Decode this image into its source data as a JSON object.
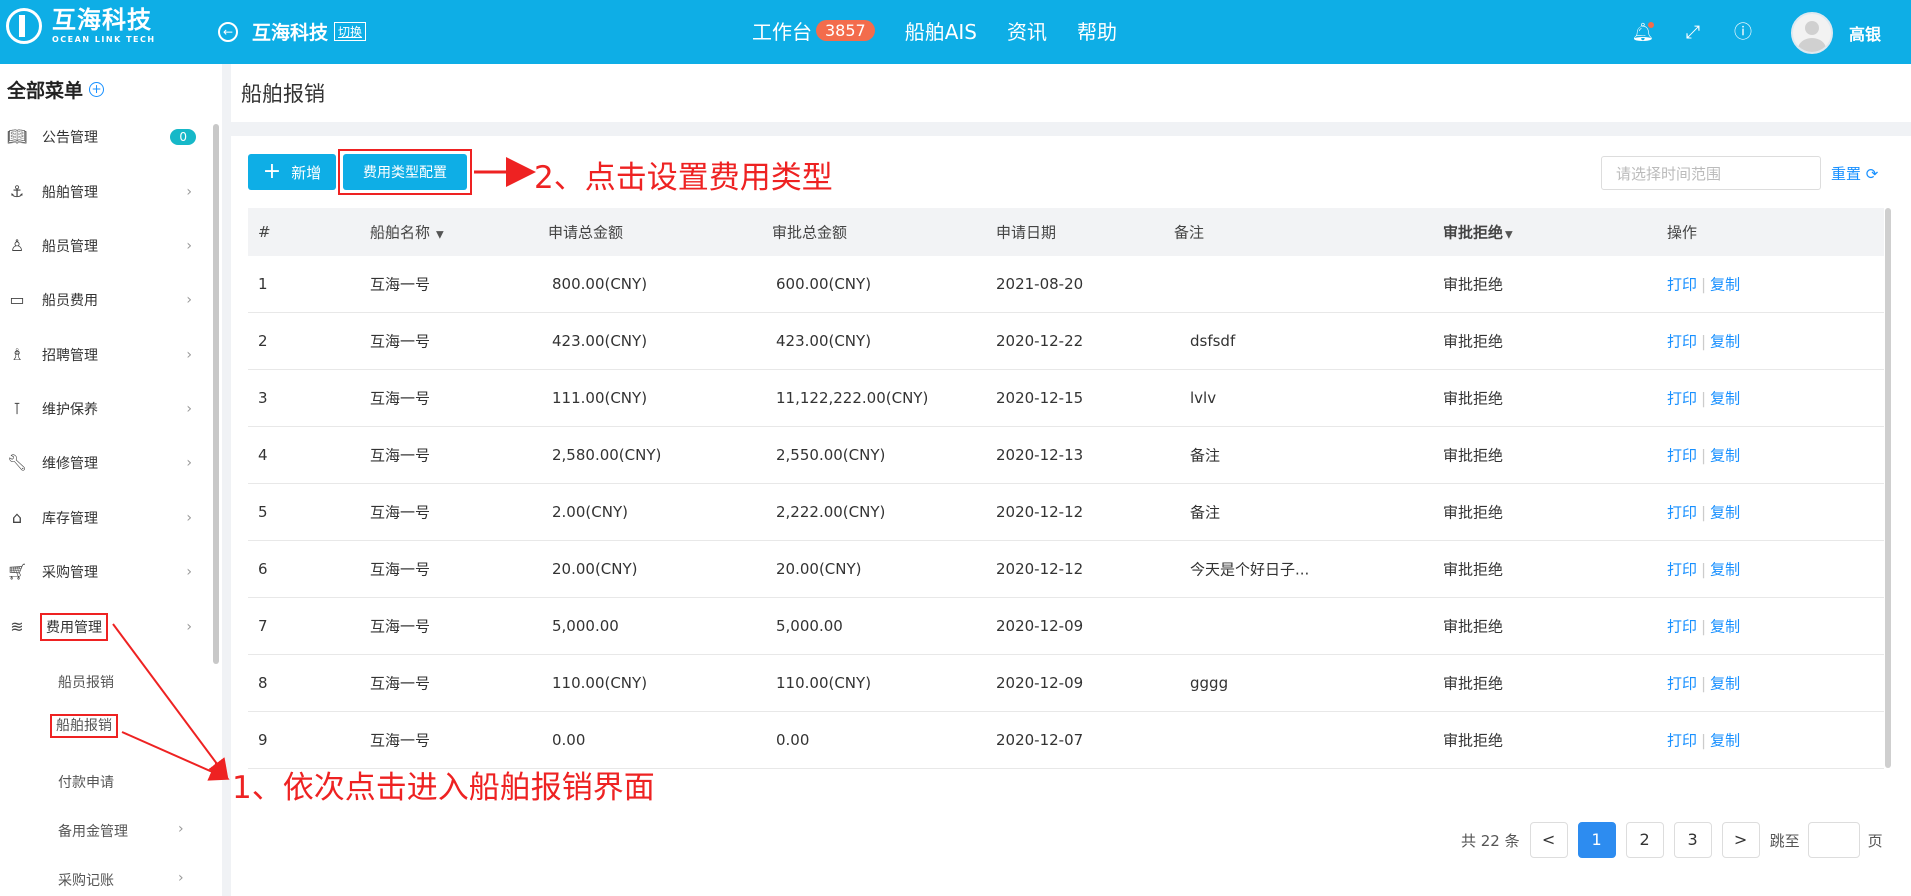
{
  "header": {
    "logo_cn": "互海科技",
    "logo_en": "OCEAN LINK TECH",
    "company": "互海科技",
    "switch_label": "切换",
    "nav": [
      {
        "label": "工作台",
        "badge": "3857"
      },
      {
        "label": "船舶AIS"
      },
      {
        "label": "资讯"
      },
      {
        "label": "帮助"
      }
    ],
    "user_name": "高银",
    "icons": [
      "bell-icon",
      "fullscreen-icon",
      "help-icon"
    ]
  },
  "sidebar": {
    "title": "全部菜单",
    "items": [
      {
        "label": "公告管理",
        "icon": "book-icon",
        "badge": "0"
      },
      {
        "label": "船舶管理",
        "icon": "anchor-icon"
      },
      {
        "label": "船员管理",
        "icon": "user-icon"
      },
      {
        "label": "船员费用",
        "icon": "wallet-icon"
      },
      {
        "label": "招聘管理",
        "icon": "recruit-icon"
      },
      {
        "label": "维护保养",
        "icon": "brush-icon"
      },
      {
        "label": "维修管理",
        "icon": "wrench-icon"
      },
      {
        "label": "库存管理",
        "icon": "home-icon"
      },
      {
        "label": "采购管理",
        "icon": "cart-icon"
      },
      {
        "label": "费用管理",
        "icon": "database-icon"
      }
    ],
    "sub_items": [
      {
        "label": "船员报销"
      },
      {
        "label": "船舶报销"
      },
      {
        "label": "付款申请"
      },
      {
        "label": "备用金管理"
      },
      {
        "label": "采购记账"
      }
    ]
  },
  "page": {
    "title": "船舶报销",
    "add_label": "新增",
    "config_label": "费用类型配置",
    "date_placeholder": "请选择时间范围",
    "reset_label": "重置"
  },
  "table": {
    "headers": [
      "#",
      "船舶名称",
      "申请总金额",
      "审批总金额",
      "申请日期",
      "备注",
      "审批拒绝",
      "操作"
    ],
    "rows": [
      {
        "no": "1",
        "ship": "互海一号",
        "apply": "800.00(CNY)",
        "approve": "600.00(CNY)",
        "date": "2021-08-20",
        "note": "",
        "status": "审批拒绝"
      },
      {
        "no": "2",
        "ship": "互海一号",
        "apply": "423.00(CNY)",
        "approve": "423.00(CNY)",
        "date": "2020-12-22",
        "note": "dsfsdf",
        "status": "审批拒绝"
      },
      {
        "no": "3",
        "ship": "互海一号",
        "apply": "111.00(CNY)",
        "approve": "11,122,222.00(CNY)",
        "date": "2020-12-15",
        "note": "lvlv",
        "status": "审批拒绝"
      },
      {
        "no": "4",
        "ship": "互海一号",
        "apply": "2,580.00(CNY)",
        "approve": "2,550.00(CNY)",
        "date": "2020-12-13",
        "note": "备注",
        "status": "审批拒绝"
      },
      {
        "no": "5",
        "ship": "互海一号",
        "apply": "2.00(CNY)",
        "approve": "2,222.00(CNY)",
        "date": "2020-12-12",
        "note": "备注",
        "status": "审批拒绝"
      },
      {
        "no": "6",
        "ship": "互海一号",
        "apply": "20.00(CNY)",
        "approve": "20.00(CNY)",
        "date": "2020-12-12",
        "note": "今天是个好日子...",
        "status": "审批拒绝"
      },
      {
        "no": "7",
        "ship": "互海一号",
        "apply": "5,000.00",
        "approve": "5,000.00",
        "date": "2020-12-09",
        "note": "",
        "status": "审批拒绝"
      },
      {
        "no": "8",
        "ship": "互海一号",
        "apply": "110.00(CNY)",
        "approve": "110.00(CNY)",
        "date": "2020-12-09",
        "note": "gggg",
        "status": "审批拒绝"
      },
      {
        "no": "9",
        "ship": "互海一号",
        "apply": "0.00",
        "approve": "0.00",
        "date": "2020-12-07",
        "note": "",
        "status": "审批拒绝"
      }
    ],
    "op_print": "打印",
    "op_copy": "复制"
  },
  "pagination": {
    "total_text": "共 22 条",
    "prev": "<",
    "pages": [
      "1",
      "2",
      "3"
    ],
    "current": "1",
    "next": ">",
    "jump_label": "跳至",
    "page_unit": "页"
  },
  "annotations": {
    "step1": "1、依次点击进入船舶报销界面",
    "step2": "2、点击设置费用类型"
  },
  "colors": {
    "header_bg": "#0eaee6",
    "badge": "#f36c4c",
    "link": "#1890ff",
    "annotation": "#ee2222",
    "pager_active": "#2d8cf0"
  }
}
